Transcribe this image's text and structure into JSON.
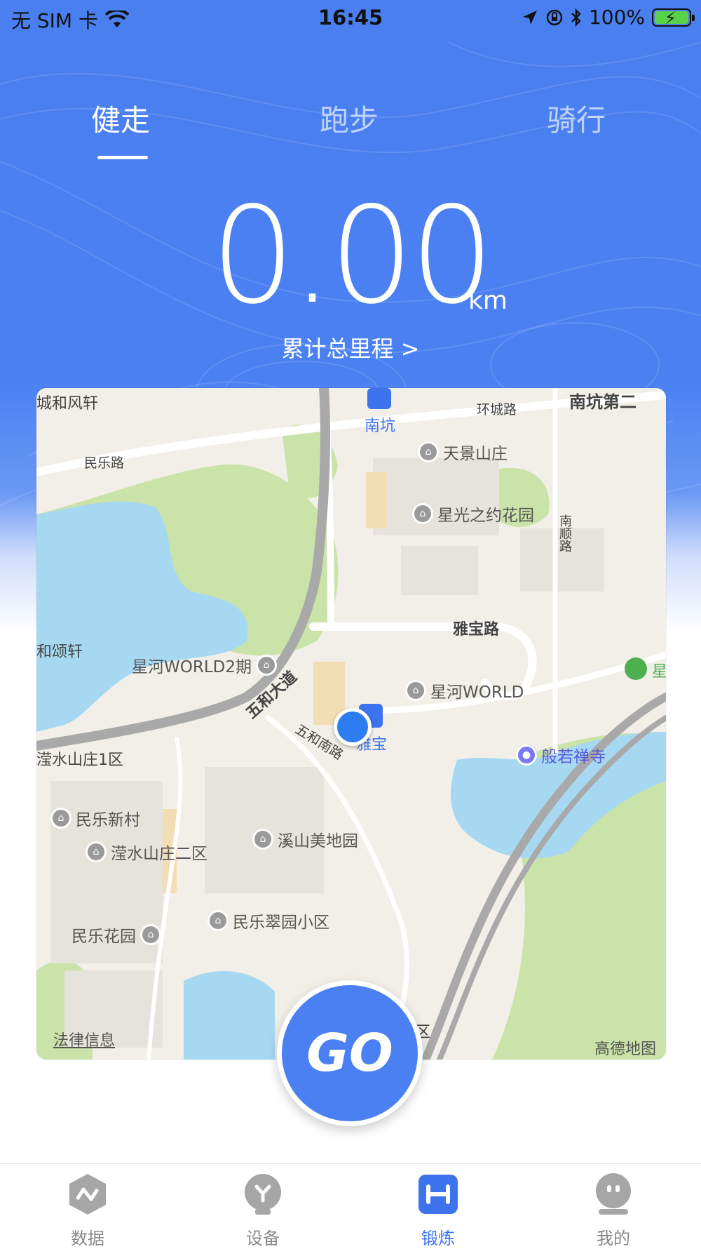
{
  "status_bar": {
    "carrier": "无 SIM 卡",
    "time": "16:45",
    "battery": "100%"
  },
  "tabs": [
    {
      "label": "健走",
      "active": true
    },
    {
      "label": "跑步",
      "active": false
    },
    {
      "label": "骑行",
      "active": false
    }
  ],
  "distance": {
    "value": "0.00",
    "unit": "km",
    "total_link": "累计总里程 >"
  },
  "map": {
    "labels": {
      "l1": "城和风轩",
      "l2": "环城路",
      "l3": "南坑第二",
      "l4": "民乐路",
      "l5": "南坑",
      "l6": "南顺路",
      "l7": "雅宝路",
      "l8": "和颂轩",
      "l9": "五和大道",
      "l10": "五和南路",
      "l11": "雅宝",
      "l12": "滢水山庄1区",
      "l13": "区",
      "l14": "星"
    },
    "pois": {
      "p1": "天景山庄",
      "p2": "星光之约花园",
      "p3": "星河WORLD2期",
      "p4": "星河WORLD",
      "p5": "般若禅寺",
      "p6": "民乐新村",
      "p7": "滢水山庄二区",
      "p8": "溪山美地园",
      "p9": "民乐花园",
      "p10": "民乐翠园小区"
    },
    "legal": "法律信息",
    "provider": "高德地图",
    "colors": {
      "water": "#a6d8f2",
      "park": "#c9e3a8",
      "road": "#ffffff",
      "highway": "#a9a9a9"
    }
  },
  "go_button": "GO",
  "nav": [
    {
      "label": "数据",
      "icon": "data-icon",
      "active": false
    },
    {
      "label": "设备",
      "icon": "device-icon",
      "active": false
    },
    {
      "label": "锻炼",
      "icon": "exercise-icon",
      "active": true
    },
    {
      "label": "我的",
      "icon": "profile-icon",
      "active": false
    }
  ],
  "colors": {
    "primary": "#4a80f2",
    "active_nav": "#3d74ee",
    "inactive_nav": "#888888"
  }
}
